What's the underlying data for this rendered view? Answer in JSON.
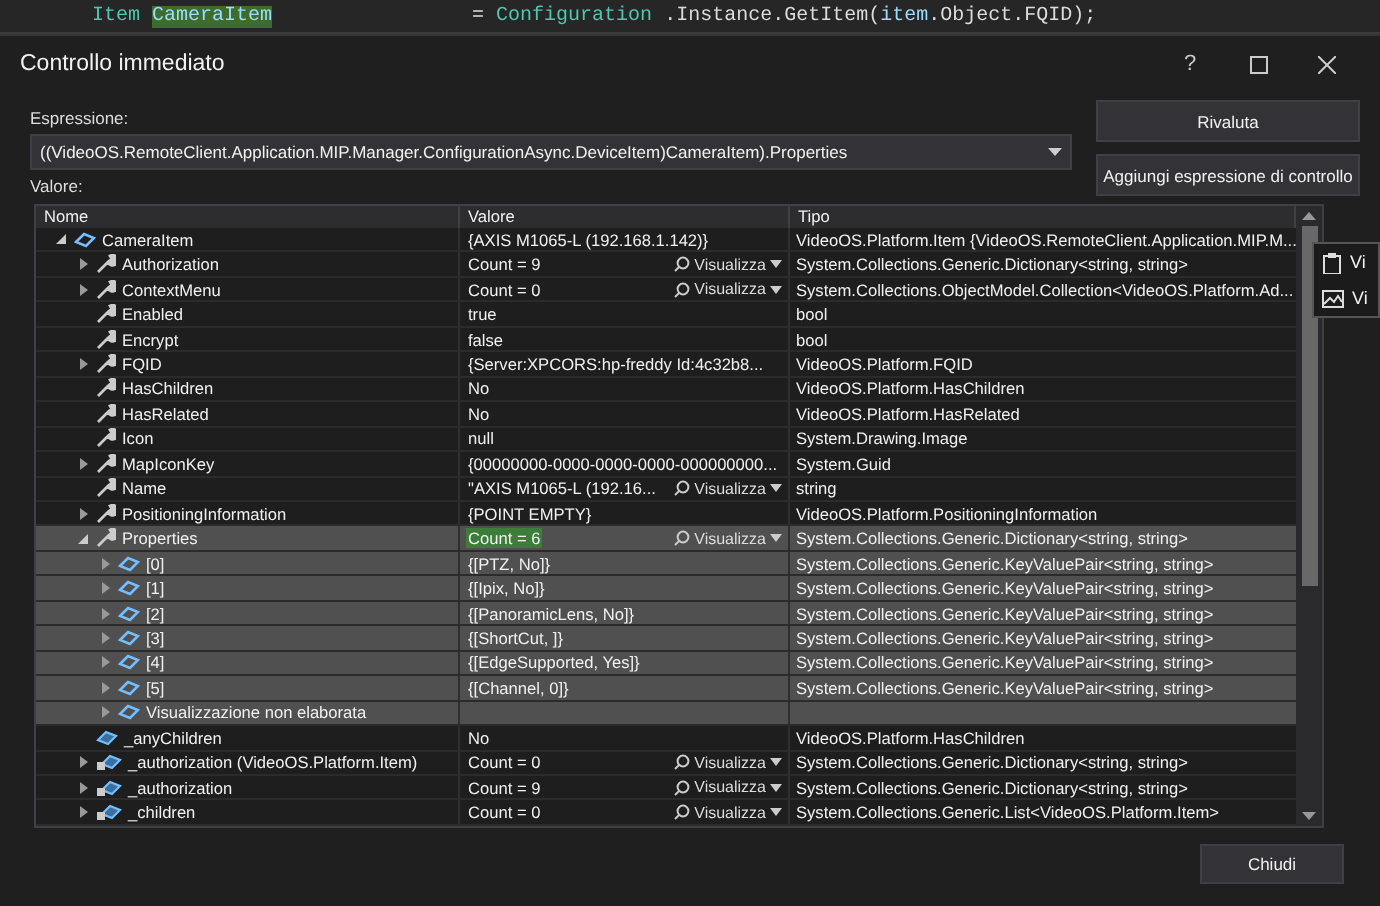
{
  "code_line": [
    {
      "kind": "type",
      "text": "Item"
    },
    {
      "kind": "highlight",
      "text": "CameraItem"
    },
    {
      "kind": "plain",
      "text": "= "
    },
    {
      "kind": "type",
      "text": "Configuration"
    },
    {
      "kind": "plain",
      "text": ".Instance.GetItem("
    },
    {
      "kind": "var",
      "text": "item"
    },
    {
      "kind": "plain",
      "text": ".Object.FQID);"
    }
  ],
  "window": {
    "title": "Controllo immediato",
    "help": "?"
  },
  "expression": {
    "label": "Espressione:",
    "value": "((VideoOS.RemoteClient.Application.MIP.Manager.ConfigurationAsync.DeviceItem)CameraItem).Properties"
  },
  "buttons": [
    "Rivaluta",
    "Aggiungi espressione di controllo"
  ],
  "value_label": "Valore:",
  "table": {
    "columns": [
      "Nome",
      "Valore",
      "Tipo"
    ],
    "rows": [
      {
        "name": "CameraItem",
        "kind": "object",
        "expanded": true,
        "selected": false,
        "value": "{AXIS M1065-L (192.168.1.142)}",
        "type": "VideoOS.Platform.Item {VideoOS.RemoteClient.Application.MIP.M...",
        "children": [
          {
            "name": "Authorization",
            "kind": "property",
            "expanded": false,
            "selected": false,
            "value": "Count = 9",
            "visualize": "Visualizza",
            "type": "System.Collections.Generic.Dictionary<string, string>"
          },
          {
            "name": "ContextMenu",
            "kind": "property",
            "expanded": false,
            "selected": false,
            "value": "Count = 0",
            "visualize": "Visualizza",
            "type": "System.Collections.ObjectModel.Collection<VideoOS.Platform.Ad..."
          },
          {
            "name": "Enabled",
            "kind": "property",
            "selected": false,
            "value": "true",
            "type": "bool"
          },
          {
            "name": "Encrypt",
            "kind": "property",
            "selected": false,
            "value": "false",
            "type": "bool"
          },
          {
            "name": "FQID",
            "kind": "property",
            "expanded": false,
            "selected": false,
            "value": "{Server:XPCORS:hp-freddy  Id:4c32b8...",
            "type": "VideoOS.Platform.FQID"
          },
          {
            "name": "HasChildren",
            "kind": "property",
            "selected": false,
            "value": "No",
            "type": "VideoOS.Platform.HasChildren"
          },
          {
            "name": "HasRelated",
            "kind": "property",
            "selected": false,
            "value": "No",
            "type": "VideoOS.Platform.HasRelated"
          },
          {
            "name": "Icon",
            "kind": "property",
            "selected": false,
            "value": "null",
            "type": "System.Drawing.Image"
          },
          {
            "name": "MapIconKey",
            "kind": "property",
            "expanded": false,
            "selected": false,
            "value": "{00000000-0000-0000-0000-000000000...",
            "type": "System.Guid"
          },
          {
            "name": "Name",
            "kind": "property",
            "selected": false,
            "value": "\"AXIS M1065-L (192.16...",
            "visualize": "Visualizza",
            "type": "string"
          },
          {
            "name": "PositioningInformation",
            "kind": "property",
            "expanded": false,
            "selected": false,
            "value": "{POINT EMPTY}",
            "type": "VideoOS.Platform.PositioningInformation"
          },
          {
            "name": "Properties",
            "kind": "property",
            "expanded": true,
            "selected": true,
            "changed": true,
            "value": "Count = 6",
            "visualize": "Visualizza",
            "type": "System.Collections.Generic.Dictionary<string, string>",
            "children": [
              {
                "name": "[0]",
                "kind": "object",
                "expanded": false,
                "selected": true,
                "value": "{[PTZ, No]}",
                "type": "System.Collections.Generic.KeyValuePair<string, string>"
              },
              {
                "name": "[1]",
                "kind": "object",
                "expanded": false,
                "selected": true,
                "value": "{[Ipix, No]}",
                "type": "System.Collections.Generic.KeyValuePair<string, string>"
              },
              {
                "name": "[2]",
                "kind": "object",
                "expanded": false,
                "selected": true,
                "value": "{[PanoramicLens, No]}",
                "type": "System.Collections.Generic.KeyValuePair<string, string>"
              },
              {
                "name": "[3]",
                "kind": "object",
                "expanded": false,
                "selected": true,
                "value": "{[ShortCut, ]}",
                "type": "System.Collections.Generic.KeyValuePair<string, string>"
              },
              {
                "name": "[4]",
                "kind": "object",
                "expanded": false,
                "selected": true,
                "value": "{[EdgeSupported, Yes]}",
                "type": "System.Collections.Generic.KeyValuePair<string, string>"
              },
              {
                "name": "[5]",
                "kind": "object",
                "expanded": false,
                "selected": true,
                "value": "{[Channel, 0]}",
                "type": "System.Collections.Generic.KeyValuePair<string, string>"
              },
              {
                "name": "Visualizzazione non elaborata",
                "kind": "object",
                "expanded": false,
                "selected": true
              }
            ]
          },
          {
            "name": "_anyChildren",
            "kind": "field",
            "selected": false,
            "value": "No",
            "type": "VideoOS.Platform.HasChildren"
          },
          {
            "name": "_authorization (VideoOS.Platform.Item)",
            "kind": "private-field",
            "expanded": false,
            "selected": false,
            "value": "Count = 0",
            "visualize": "Visualizza",
            "type": "System.Collections.Generic.Dictionary<string, string>"
          },
          {
            "name": "_authorization",
            "kind": "private-field",
            "expanded": false,
            "selected": false,
            "value": "Count = 9",
            "visualize": "Visualizza",
            "type": "System.Collections.Generic.Dictionary<string, string>"
          },
          {
            "name": "_children",
            "kind": "private-field",
            "expanded": false,
            "selected": false,
            "value": "Count = 0",
            "visualize": "Visualizza",
            "type": "System.Collections.Generic.List<VideoOS.Platform.Item>"
          }
        ]
      }
    ]
  },
  "side_menu": [
    {
      "kind": "clipboard",
      "label": "Vi"
    },
    {
      "kind": "image",
      "label": "Vi"
    }
  ],
  "close_button": "Chiudi"
}
